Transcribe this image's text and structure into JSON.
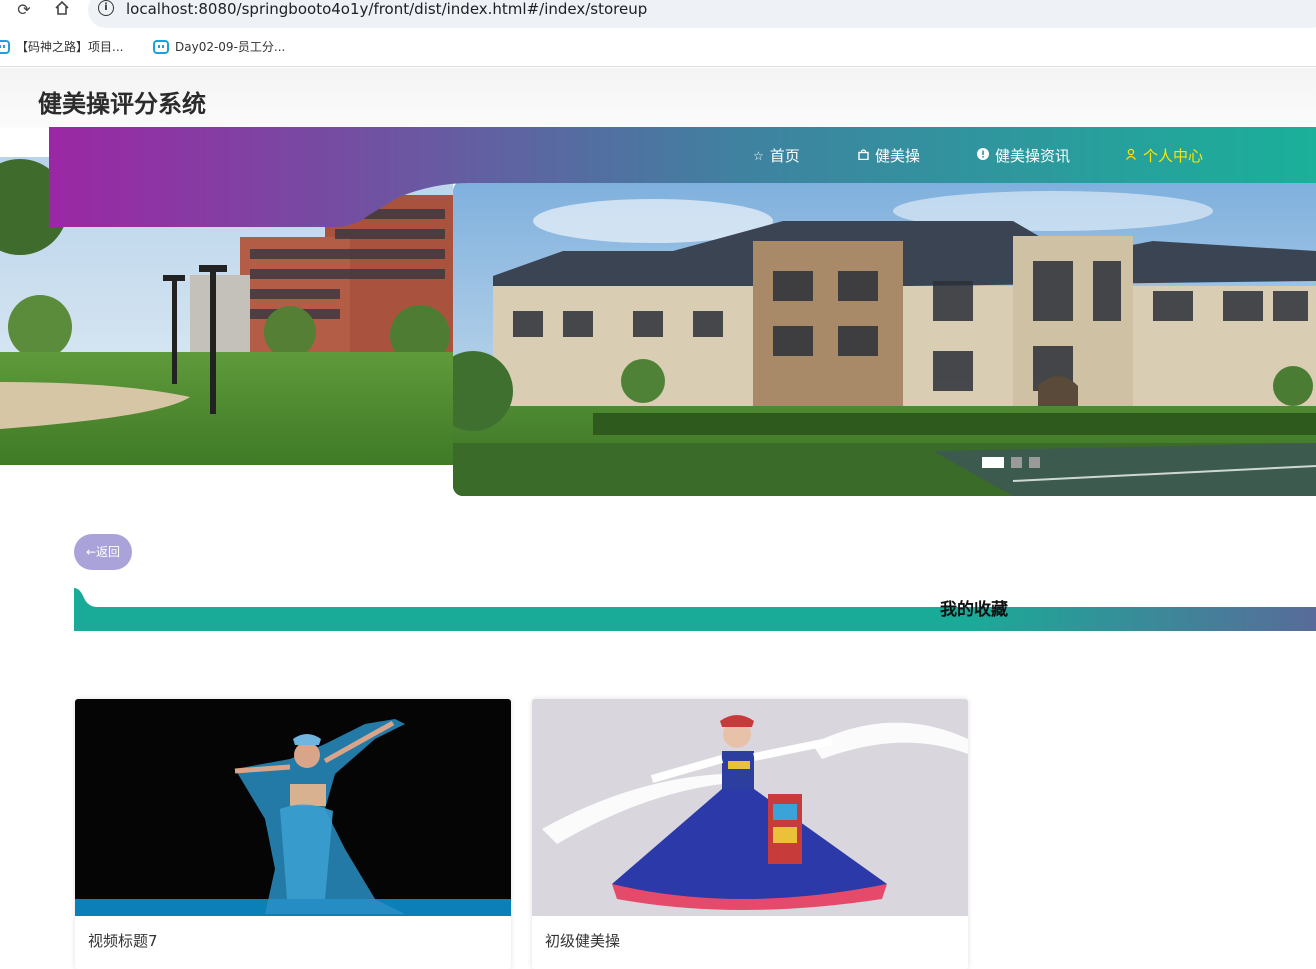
{
  "browser": {
    "url": "localhost:8080/springbooto4o1y/front/dist/index.html#/index/storeup",
    "bookmarks": [
      {
        "label": "【码神之路】项目..."
      },
      {
        "label": "Day02-09-员工分..."
      }
    ]
  },
  "header": {
    "title": "健美操评分系统"
  },
  "nav": {
    "items": [
      {
        "label": "首页",
        "icon": "star-icon"
      },
      {
        "label": "健美操",
        "icon": "bag-icon"
      },
      {
        "label": "健美操资讯",
        "icon": "info-circle-icon"
      },
      {
        "label": "个人中心",
        "icon": "user-icon",
        "active": true
      }
    ],
    "gradient": [
      "#9b27a4",
      "#3f82a0",
      "#1ab09a"
    ],
    "active_color": "#ffe600"
  },
  "carousel": {
    "slide_count": 3,
    "active_index": 0
  },
  "page": {
    "back_label": "←返回",
    "section_title": "我的收藏",
    "accent": "#1aab98"
  },
  "cards": [
    {
      "title": "视频标题7"
    },
    {
      "title": "初级健美操"
    }
  ]
}
